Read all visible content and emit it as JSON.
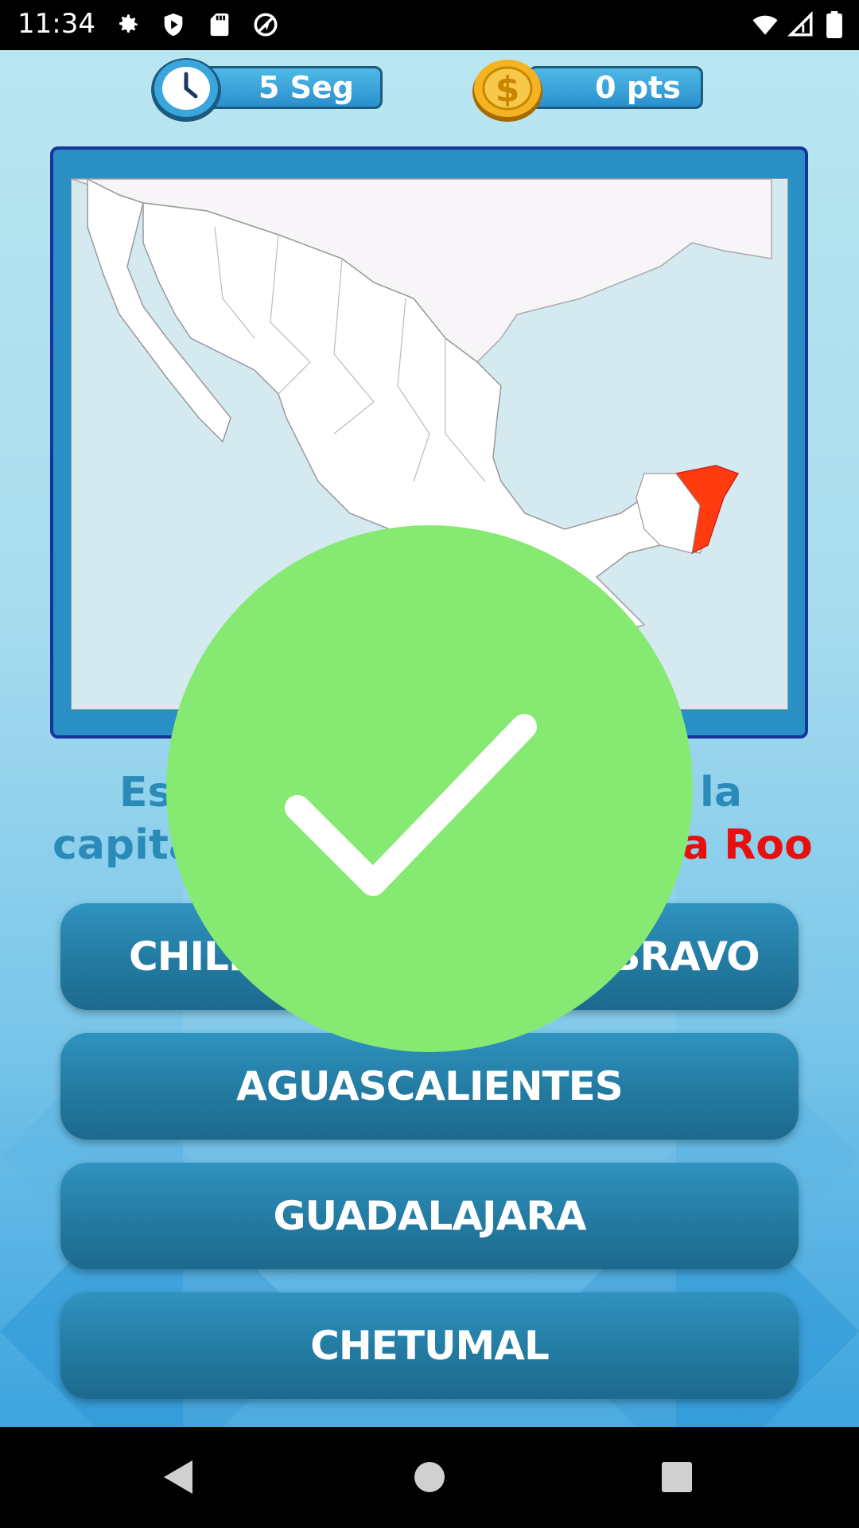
{
  "status_bar": {
    "time": "11:34",
    "icons": [
      "gear-icon",
      "shield-play-icon",
      "sd-card-icon",
      "no-location-icon",
      "wifi-icon",
      "signal-icon",
      "battery-icon"
    ]
  },
  "hud": {
    "timer_label": "5 Seg",
    "points_label": "0 pts",
    "timer_icon": "clock-icon",
    "points_icon": "coin-icon"
  },
  "map": {
    "region": "Mexico",
    "highlighted_state_color": "#ff3b0f"
  },
  "question": {
    "line1_visible_left": "Esc",
    "line1_visible_right": "la",
    "line2_visible_left": "capita",
    "line2_visible_right": "na Roo"
  },
  "answers": [
    {
      "visible_left": "CHILPAN",
      "visible_right": "S BRAVO"
    },
    {
      "label": "AGUASCALIENTES"
    },
    {
      "label": "GUADALAJARA"
    },
    {
      "label": "CHETUMAL"
    }
  ],
  "overlay": {
    "icon": "checkmark-icon",
    "color": "#86ea72"
  },
  "colors": {
    "accent": "#2a8bb8",
    "highlight": "#e8100e",
    "button": "#237aa1"
  },
  "nav": {
    "back_icon": "back-triangle-icon",
    "home_icon": "home-circle-icon",
    "recents_icon": "recents-square-icon"
  }
}
